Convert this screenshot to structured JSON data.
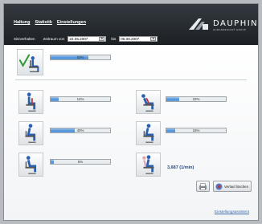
{
  "nav": [
    "Haltung",
    "Statistik",
    "Einstellungen"
  ],
  "filter": {
    "label": "Sitzverhalten",
    "from_label": "Zeitraum von",
    "from_date": "22.05.2007",
    "to_label": "bis",
    "to_date": "05.06.2007"
  },
  "brand": {
    "name": "DAUPHIN",
    "tagline": "HUMANDESIGN® GROUP"
  },
  "summary": {
    "value": 0.63,
    "label": "63%"
  },
  "postures": [
    {
      "value": 0.14,
      "label": "14%"
    },
    {
      "value": 0.22,
      "label": "22%"
    },
    {
      "value": 0.4,
      "label": "40%"
    },
    {
      "value": 0.15,
      "label": "15%"
    },
    {
      "value": 0.05,
      "label": "5%"
    }
  ],
  "usage": "3,687 (1/min)",
  "buttons": {
    "delete": "Verlauf löschen"
  },
  "assistant_link": "Einstellungsassistent"
}
